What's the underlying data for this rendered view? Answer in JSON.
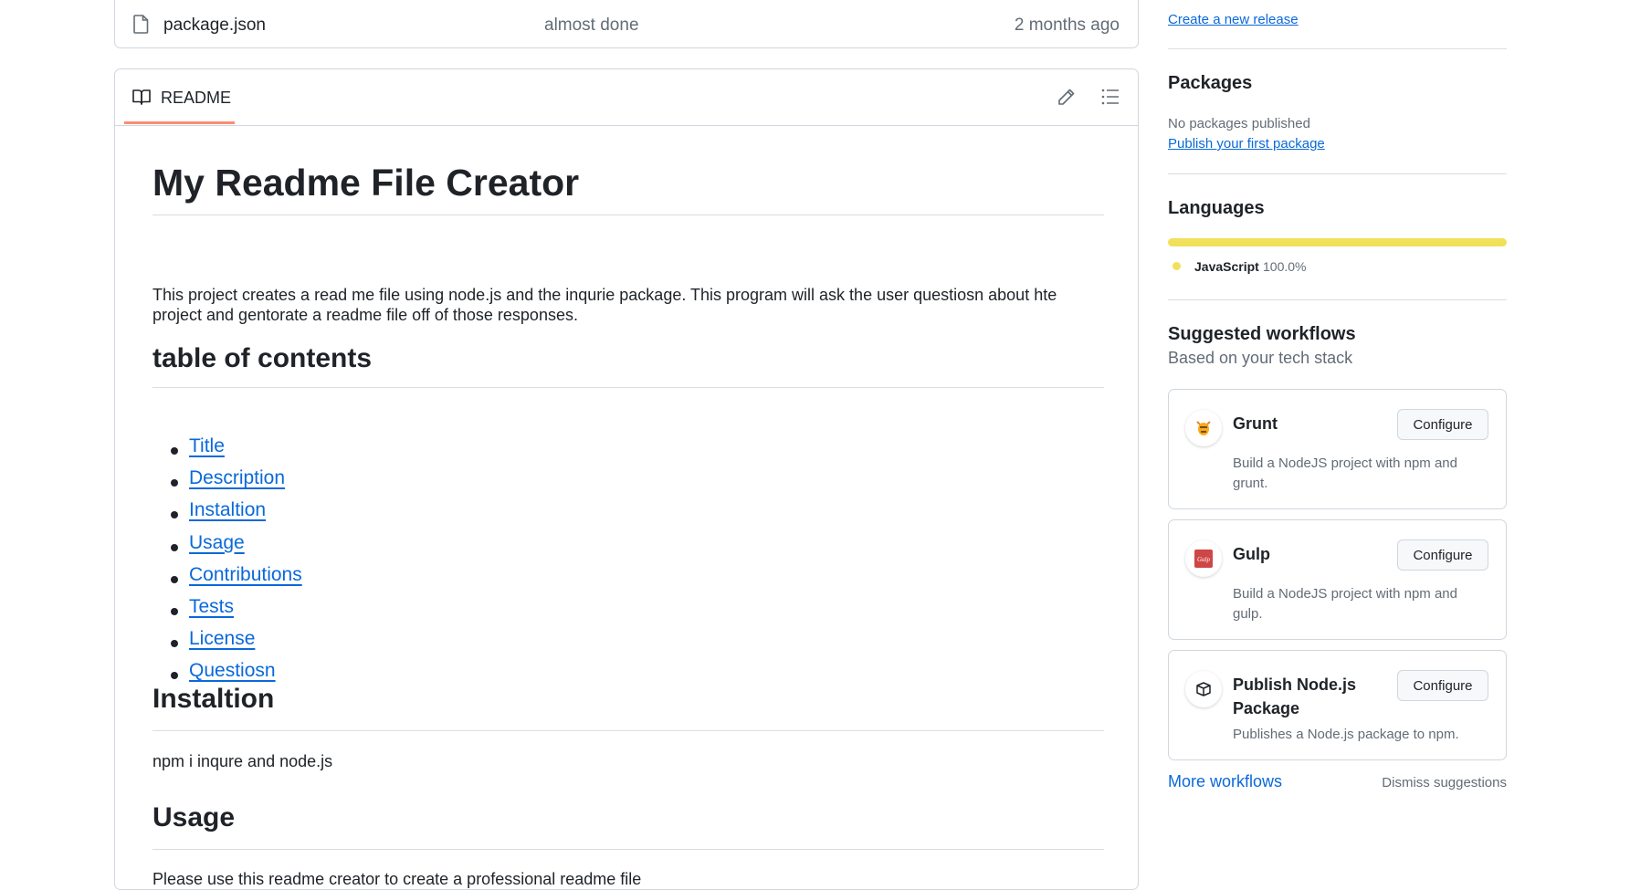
{
  "files": {
    "row": {
      "name": "package.json",
      "commit_message": "almost done",
      "date": "2 months ago"
    }
  },
  "readme": {
    "tab_label": "README",
    "title": "My Readme File Creator",
    "description": "This project creates a read me file using node.js and the inqurie package. This program will ask the user questiosn about hte project and gentorate a readme file off of those responses.",
    "toc_heading": "table of contents",
    "toc": [
      "Title",
      "Description",
      "Instaltion",
      "Usage",
      "Contributions",
      "Tests",
      "License",
      "Questiosn"
    ],
    "install_heading": "Instaltion",
    "install_text": "npm i inqure and node.js",
    "usage_heading": "Usage",
    "usage_text": "Please use this readme creator to create a professional readme file"
  },
  "sidebar": {
    "release_link": "Create a new release",
    "packages": {
      "heading": "Packages",
      "empty_text": "No packages published",
      "link": "Publish your first package"
    },
    "languages": {
      "heading": "Languages",
      "items": [
        {
          "name": "JavaScript",
          "percent": "100.0%",
          "color": "#f1e05a"
        }
      ]
    },
    "workflows": {
      "heading": "Suggested workflows",
      "subheading": "Based on your tech stack",
      "items": [
        {
          "name": "Grunt",
          "description": "Build a NodeJS project with npm and grunt.",
          "button": "Configure",
          "icon": "grunt-icon"
        },
        {
          "name": "Gulp",
          "description": "Build a NodeJS project with npm and gulp.",
          "button": "Configure",
          "icon": "gulp-icon"
        },
        {
          "name": "Publish Node.js Package",
          "description": "Publishes a Node.js package to npm.",
          "button": "Configure",
          "icon": "package-icon"
        }
      ],
      "more_link": "More workflows",
      "dismiss": "Dismiss suggestions"
    }
  }
}
